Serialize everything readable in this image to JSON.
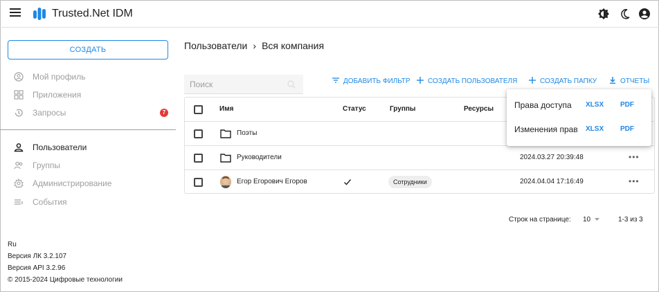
{
  "app": {
    "title": "Trusted.Net IDM",
    "accent_color": "#1e88e5"
  },
  "header": {
    "icons": [
      "menu-icon",
      "brightness-icon",
      "dark-mode-icon",
      "account-icon"
    ]
  },
  "sidebar": {
    "create_label": "СОЗДАТЬ",
    "items": [
      {
        "label": "Мой профиль",
        "icon": "account-circle-icon"
      },
      {
        "label": "Приложения",
        "icon": "apps-icon"
      },
      {
        "label": "Запросы",
        "icon": "history-icon",
        "badge": "7"
      },
      {
        "label": "Пользователи",
        "icon": "person-icon"
      },
      {
        "label": "Группы",
        "icon": "group-icon"
      },
      {
        "label": "Администрирование",
        "icon": "settings-icon"
      },
      {
        "label": "События",
        "icon": "events-icon"
      }
    ],
    "footer": {
      "language": "Ru",
      "version_lk": "Версия ЛК 3.2.107",
      "version_api": "Версия API 3.2.96",
      "copyright": "© 2015-2024 Цифровые технологии"
    }
  },
  "main": {
    "breadcrumb": {
      "root": "Пользователи",
      "separator": "›",
      "current": "Вся компания"
    },
    "search": {
      "placeholder": "Поиск",
      "value": ""
    },
    "toolbar": {
      "add_filter": "ДОБАВИТЬ ФИЛЬТР",
      "create_user": "СОЗДАТЬ ПОЛЬЗОВАТЕЛЯ",
      "create_folder": "СОЗДАТЬ ПАПКУ",
      "reports": "ОТЧЕТЫ"
    },
    "table": {
      "columns": [
        "Имя",
        "Статус",
        "Группы",
        "Ресурсы"
      ],
      "rows": [
        {
          "type": "folder",
          "name": "Поэты",
          "status": "",
          "group": "",
          "date": "",
          "more": "•••"
        },
        {
          "type": "folder",
          "name": "Руководители",
          "status": "",
          "group": "",
          "date": "2024.03.27 20:39:48",
          "more": "•••"
        },
        {
          "type": "user",
          "name": "Егор Егорович Егоров",
          "status": "✓",
          "group": "Сотрудники",
          "date": "2024.04.04 17:16:49",
          "more": "•••"
        }
      ]
    },
    "pagination": {
      "rows_per_page_label": "Строк на странице:",
      "rows_per_page_value": "10",
      "range": "1-3 из 3"
    },
    "reports_menu": [
      {
        "label": "Права доступа",
        "xlsx": "XLSX",
        "pdf": "PDF"
      },
      {
        "label": "Изменения прав",
        "xlsx": "XLSX",
        "pdf": "PDF"
      }
    ]
  }
}
